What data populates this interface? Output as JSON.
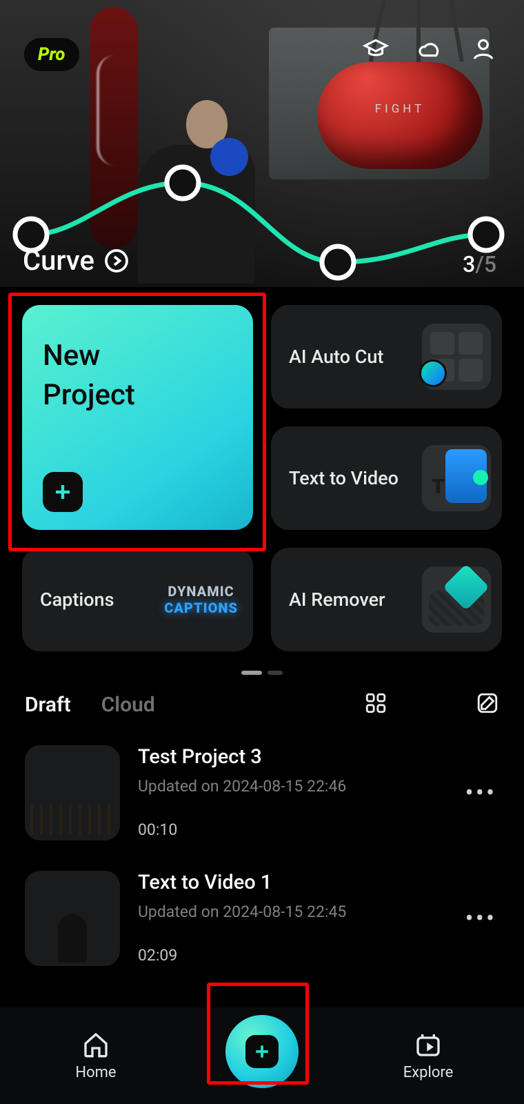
{
  "badge": {
    "pro": "Pro"
  },
  "hero": {
    "title": "Curve",
    "bag_text": "FIGHT",
    "page_current": "3",
    "page_total": "/5"
  },
  "tiles": {
    "new_project": "New\nProject",
    "ai_auto_cut": "AI Auto Cut",
    "text_to_video": "Text to Video",
    "captions": "Captions",
    "captions_anim_line1": "DYNAMIC",
    "captions_anim_line2": "CAPTIONS",
    "ai_remover": "AI Remover"
  },
  "section": {
    "tab_draft": "Draft",
    "tab_cloud": "Cloud"
  },
  "drafts": [
    {
      "title": "Test Project 3",
      "meta": "Updated on 2024-08-15 22:46",
      "duration": "00:10"
    },
    {
      "title": "Text to Video 1",
      "meta": "Updated on 2024-08-15 22:45",
      "duration": "02:09"
    }
  ],
  "nav": {
    "home": "Home",
    "explore": "Explore"
  }
}
